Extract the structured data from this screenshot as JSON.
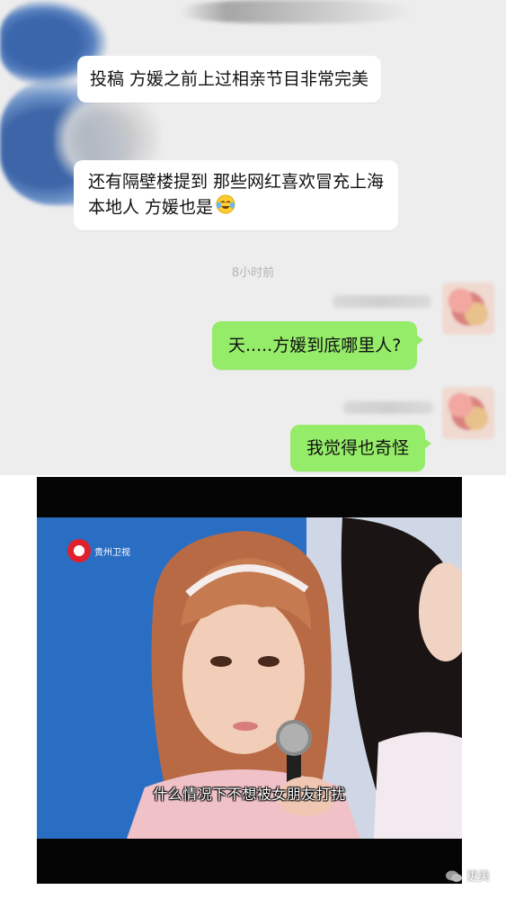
{
  "chat": {
    "messages": [
      {
        "text": "投稿 方媛之前上过相亲节目非常完美"
      },
      {
        "line1": "还有隔壁楼提到 那些网红喜欢冒充上海",
        "line2": "本地人 方媛也是",
        "emoji_icon": "tears-of-joy-emoji-icon"
      },
      {
        "text": "天.....方媛到底哪里人?"
      },
      {
        "text": "我觉得也奇怪"
      }
    ],
    "timestamp": "8小时前",
    "colors": {
      "incoming": "#ffffff",
      "outgoing": "#95ec69",
      "background": "#ededed"
    }
  },
  "video": {
    "channel_logo_text": "贵州卫视",
    "subtitle": "什么情况下不想被女朋友打扰"
  },
  "watermark": {
    "text": "更美"
  }
}
